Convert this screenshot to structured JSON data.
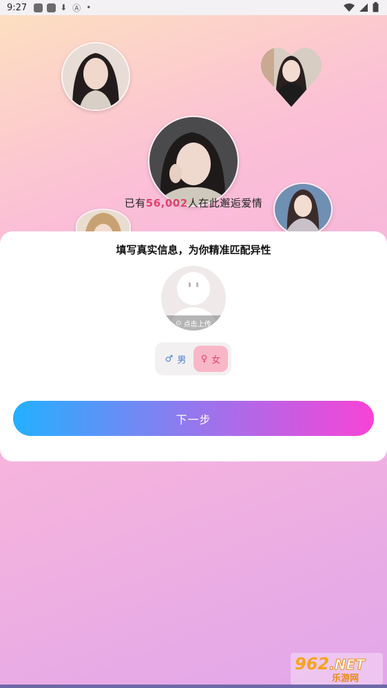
{
  "status_bar": {
    "time": "9:27",
    "icons": [
      "app-icon",
      "app-icon",
      "download-icon",
      "a-icon",
      "dot-icon"
    ],
    "right_icons": [
      "wifi-icon",
      "signal-icon",
      "battery-icon"
    ]
  },
  "hero": {
    "stat_prefix": "已有",
    "stat_count": "56,002",
    "stat_suffix": "人在此邂逅爱情"
  },
  "card": {
    "title": "填写真实信息，为你精准匹配异性",
    "upload_label": "点击上传",
    "gender": {
      "male_label": "男",
      "female_label": "女",
      "selected": "female"
    },
    "next_label": "下一步"
  },
  "watermark": {
    "brand": "962",
    "tld": ".NET",
    "name": "乐游网"
  }
}
